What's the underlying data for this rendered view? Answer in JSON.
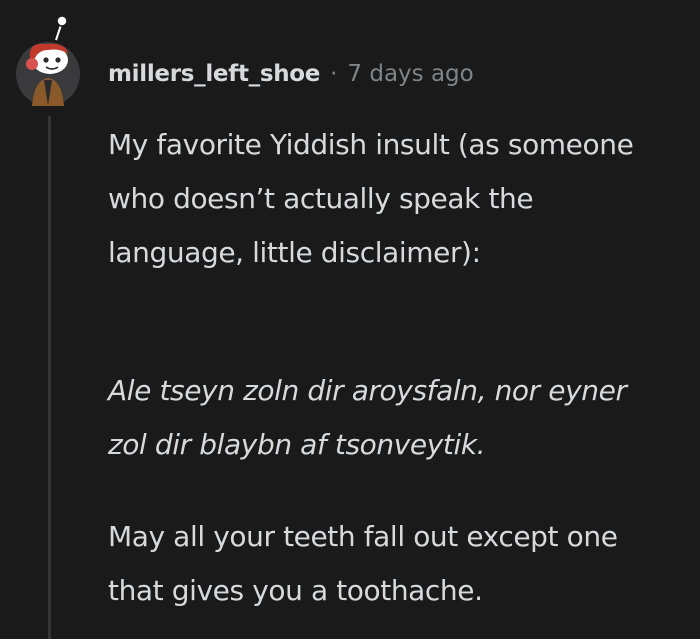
{
  "comment": {
    "author": "millers_left_shoe",
    "separator": "·",
    "timestamp": "7 days ago",
    "avatar_icon": "snoo-avatar-icon",
    "paragraphs": [
      "My favorite Yiddish insult (as someone who doesn’t actually speak the language, little disclaimer):",
      "Ale tseyn zoln dir aroysfaln, nor eyner zol dir blaybn af tsonveytik.",
      "May all your teeth fall out except one that gives you a toothache."
    ]
  },
  "colors": {
    "background": "#1a1a1b",
    "text": "#d7dadc",
    "meta": "#818384",
    "thread_line": "#343536"
  }
}
